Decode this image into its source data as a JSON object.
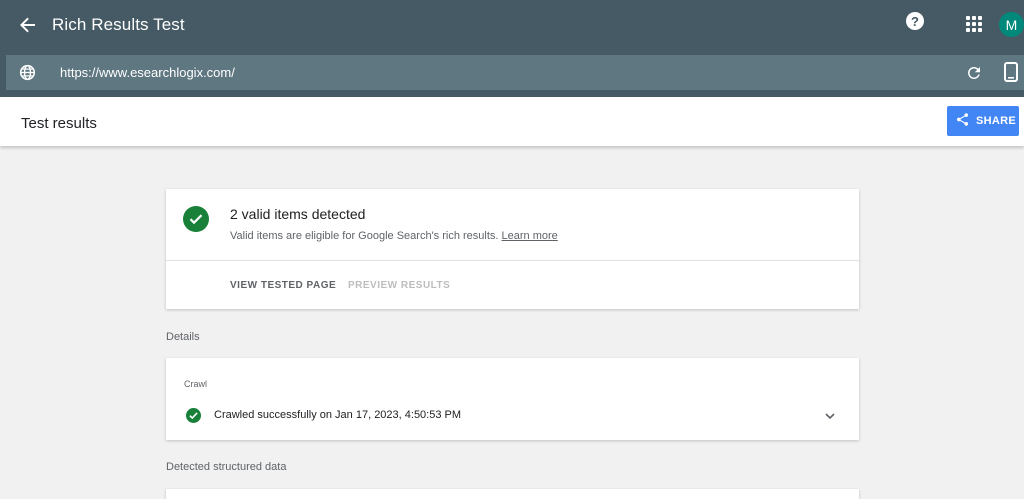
{
  "app": {
    "title": "Rich Results Test",
    "avatar_initial": "M"
  },
  "urlbar": {
    "url": "https://www.esearchlogix.com/"
  },
  "results": {
    "title": "Test results",
    "share_label": "SHARE"
  },
  "summary": {
    "title": "2 valid items detected",
    "subtitle": "Valid items are eligible for Google Search's rich results.",
    "learn_more": "Learn more",
    "tabs": [
      {
        "label": "VIEW TESTED PAGE",
        "state": "active"
      },
      {
        "label": "PREVIEW RESULTS",
        "state": "disabled"
      }
    ]
  },
  "details": {
    "section_label": "Details",
    "crawl_label": "Crawl",
    "crawl_status": "Crawled successfully on Jan 17, 2023, 4:50:53 PM"
  },
  "structured": {
    "section_label": "Detected structured data"
  },
  "icons": {
    "back": "arrow-back-icon",
    "help": "help-icon",
    "apps": "apps-grid-icon",
    "globe": "globe-icon",
    "reload": "reload-icon",
    "device": "smartphone-icon",
    "share": "share-icon",
    "valid": "check-circle-icon",
    "expand": "chevron-down-icon"
  },
  "colors": {
    "topbar": "#455a64",
    "urlbar": "#5f7781",
    "accent": "#4285f4",
    "success": "#188038",
    "avatar": "#00897b"
  }
}
